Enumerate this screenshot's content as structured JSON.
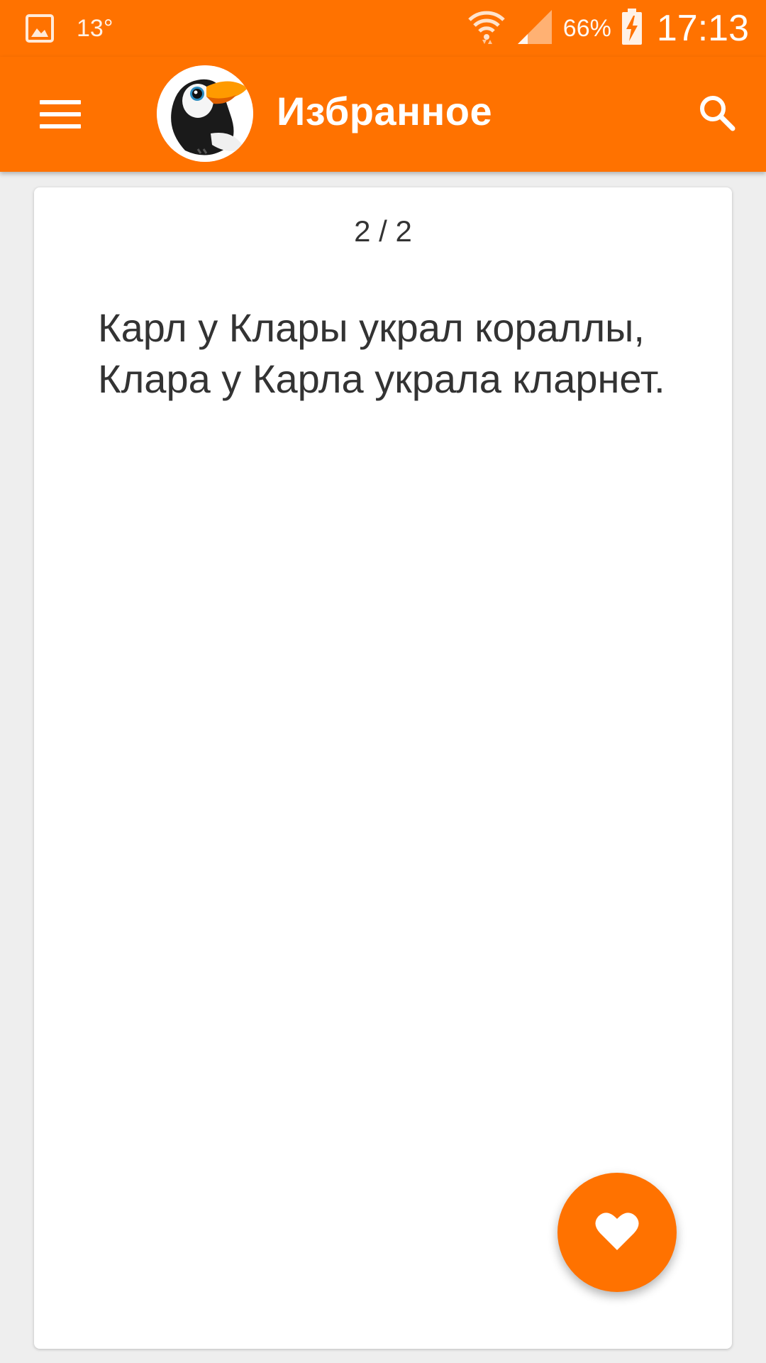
{
  "status_bar": {
    "temperature": "13°",
    "battery_percent": "66%",
    "time": "17:13",
    "icons": [
      "gallery-icon",
      "wifi-icon",
      "signal-icon",
      "battery-charging-icon"
    ]
  },
  "toolbar": {
    "title": "Избранное",
    "menu_icon": "menu-icon",
    "search_icon": "search-icon",
    "logo": "toucan-logo"
  },
  "card": {
    "counter": "2 / 2",
    "text": "Карл у Клары украл кораллы, Клара у Карла украла кларнет."
  },
  "fab": {
    "icon": "heart-icon"
  },
  "colors": {
    "accent": "#ff7200",
    "background": "#eeeeee",
    "card": "#ffffff",
    "text": "#333333"
  }
}
